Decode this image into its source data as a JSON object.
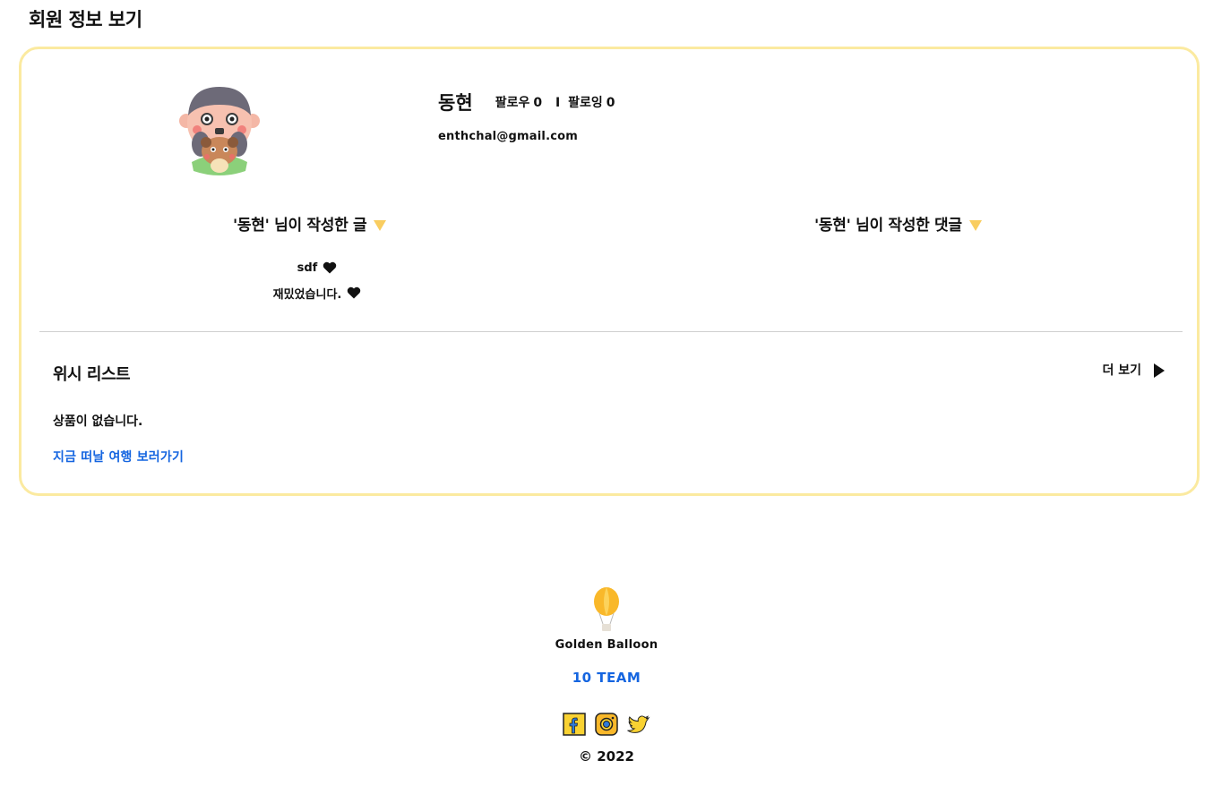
{
  "page": {
    "title": "회원 정보 보기"
  },
  "profile": {
    "name": "동현",
    "follower_label": "팔로우",
    "follower_count": "0",
    "separator": "I",
    "following_label": "팔로잉",
    "following_count": "0",
    "email": "enthchal@gmail.com",
    "avatar_icon": "boy-with-dog-avatar"
  },
  "posts": {
    "header": "'동현' 님이 작성한 글",
    "items": [
      {
        "title": "sdf",
        "icon": "heart-icon"
      },
      {
        "title": "재밌었습니다.",
        "icon": "heart-icon"
      }
    ]
  },
  "comments": {
    "header": "'동현' 님이 작성한 댓글",
    "items": []
  },
  "wishlist": {
    "title": "위시 리스트",
    "more_label": "더 보기",
    "empty_text": "상품이 없습니다.",
    "link_text": "지금 떠날 여행 보러가기"
  },
  "footer": {
    "brand": "Golden Balloon",
    "team": "10 TEAM",
    "social": [
      "facebook-icon",
      "instagram-icon",
      "twitter-icon"
    ],
    "copyright": "© 2022"
  },
  "colors": {
    "card_border": "#fbeaa0",
    "accent_yellow": "#f9cd60",
    "link_blue": "#1565e0"
  }
}
